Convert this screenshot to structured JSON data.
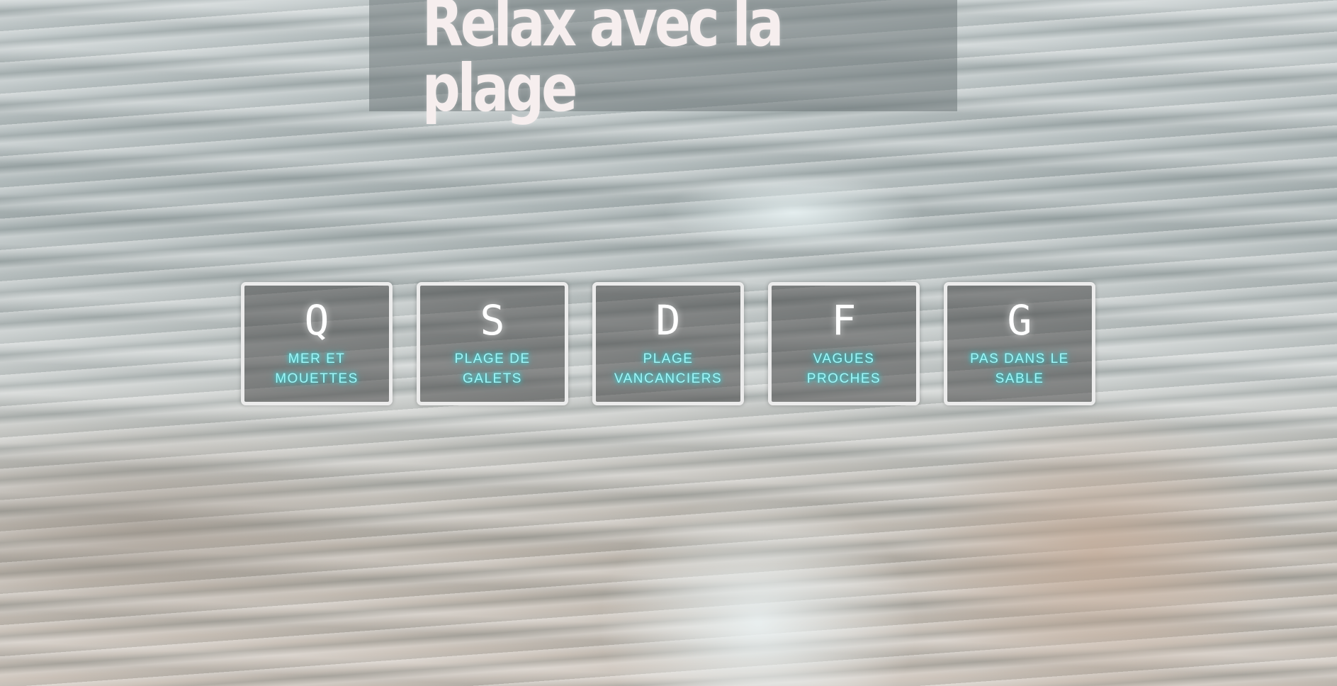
{
  "page": {
    "title": "Relax avec la plage"
  },
  "keys": [
    {
      "key": "Q",
      "label": "MER ET MOUETTES"
    },
    {
      "key": "S",
      "label": "PLAGE DE GALETS"
    },
    {
      "key": "D",
      "label": "PLAGE VANCANCIERS"
    },
    {
      "key": "F",
      "label": "VAGUES PROCHES"
    },
    {
      "key": "G",
      "label": "PAS DANS LE SABLE"
    }
  ],
  "colors": {
    "label_glow": "#18e5ea",
    "label_text": "#9ff5f7",
    "key_border": "#ececec",
    "title_text": "#f6eeee"
  }
}
